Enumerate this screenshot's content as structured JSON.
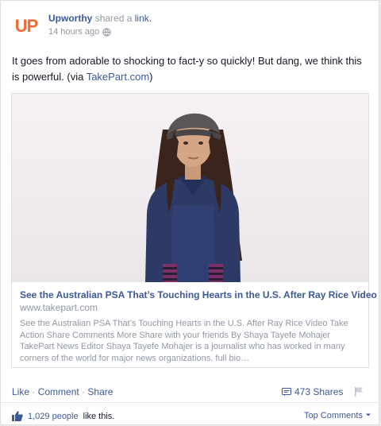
{
  "post": {
    "author": "Upworthy",
    "shared_text": "shared a",
    "shared_object": "link.",
    "timestamp": "14 hours ago",
    "message_prefix": "It goes from adorable to shocking to fact-y so quickly! But dang, we think this is powerful. (via ",
    "message_link": "TakePart.com",
    "message_suffix": ")"
  },
  "logo": {
    "text": "UP",
    "color": "#f06a35"
  },
  "attachment": {
    "title": "See the Australian PSA That’s Touching Hearts in the U.S. After Ray Rice Video",
    "domain": "www.takepart.com",
    "description": "See the Australian PSA That’s Touching Hearts in the U.S. After Ray Rice Video Take Action Share Comments More Share with your friends By Shaya Tayefe Mohajer TakePart News Editor Shaya Tayefe Mohajer is a journalist who has worked in many corners of the world for major news organizations. full bio…"
  },
  "actions": {
    "like": "Like",
    "comment": "Comment",
    "share": "Share",
    "separator": "·",
    "shares_count": "473 Shares"
  },
  "footer": {
    "likes_count": "1,029 people",
    "likes_suffix": "like this.",
    "top_comments": "Top Comments"
  },
  "colors": {
    "link": "#3b5998",
    "muted": "#9197a3"
  }
}
